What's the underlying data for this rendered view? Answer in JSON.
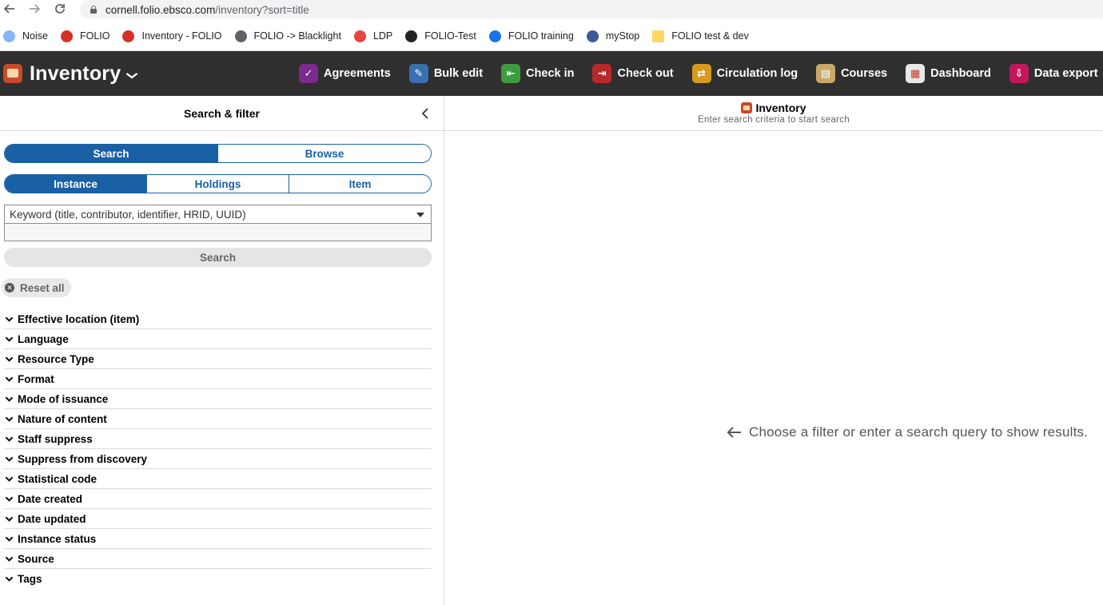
{
  "browser": {
    "url_host": "cornell.folio.ebsco.com",
    "url_path": "/inventory?sort=title",
    "bookmarks": [
      {
        "label": "Noise",
        "icon": "noise-icon",
        "color": "#8ab4f8"
      },
      {
        "label": "FOLIO",
        "icon": "folio-gear-icon",
        "color": "#d93025"
      },
      {
        "label": "Inventory - FOLIO",
        "icon": "folio-gear-icon",
        "color": "#d93025"
      },
      {
        "label": "FOLIO -> Blacklight",
        "icon": "globe-icon",
        "color": "#5f6368"
      },
      {
        "label": "LDP",
        "icon": "ldp-icon",
        "color": "#e8453c"
      },
      {
        "label": "FOLIO-Test",
        "icon": "gear-icon",
        "color": "#202124"
      },
      {
        "label": "FOLIO training",
        "icon": "gear-icon",
        "color": "#1a73e8"
      },
      {
        "label": "myStop",
        "icon": "mystop-icon",
        "color": "#3b5998"
      },
      {
        "label": "FOLIO test & dev",
        "icon": "folder-icon",
        "color": "#fdd663"
      }
    ]
  },
  "app": {
    "title": "Inventory",
    "nav": [
      {
        "label": "Agreements",
        "icon": "agreements-icon",
        "color": "#7b2a8e",
        "glyph": "✓"
      },
      {
        "label": "Bulk edit",
        "icon": "bulk-edit-icon",
        "color": "#3a6fb0",
        "glyph": "✎"
      },
      {
        "label": "Check in",
        "icon": "check-in-icon",
        "color": "#3f9b3f",
        "glyph": "⇤"
      },
      {
        "label": "Check out",
        "icon": "check-out-icon",
        "color": "#b8282c",
        "glyph": "⇥"
      },
      {
        "label": "Circulation log",
        "icon": "circulation-log-icon",
        "color": "#d69a1c",
        "glyph": "⇄"
      },
      {
        "label": "Courses",
        "icon": "courses-icon",
        "color": "#c7a867",
        "glyph": "▤"
      },
      {
        "label": "Dashboard",
        "icon": "dashboard-icon",
        "color": "#e8e8e8",
        "glyph": "▦"
      },
      {
        "label": "Data export",
        "icon": "data-export-icon",
        "color": "#c2185b",
        "glyph": "⇩"
      }
    ]
  },
  "search_pane": {
    "title": "Search & filter",
    "segment_mode": [
      "Search",
      "Browse"
    ],
    "segment_record": [
      "Instance",
      "Holdings",
      "Item"
    ],
    "search_option": "Keyword (title, contributor, identifier, HRID, UUID)",
    "search_button": "Search",
    "reset_label": "Reset all",
    "filters": [
      "Effective location (item)",
      "Language",
      "Resource Type",
      "Format",
      "Mode of issuance",
      "Nature of content",
      "Staff suppress",
      "Suppress from discovery",
      "Statistical code",
      "Date created",
      "Date updated",
      "Instance status",
      "Source",
      "Tags"
    ]
  },
  "results_pane": {
    "title": "Inventory",
    "subtitle": "Enter search criteria to start search",
    "empty_message": "Choose a filter or enter a search query to show results."
  }
}
